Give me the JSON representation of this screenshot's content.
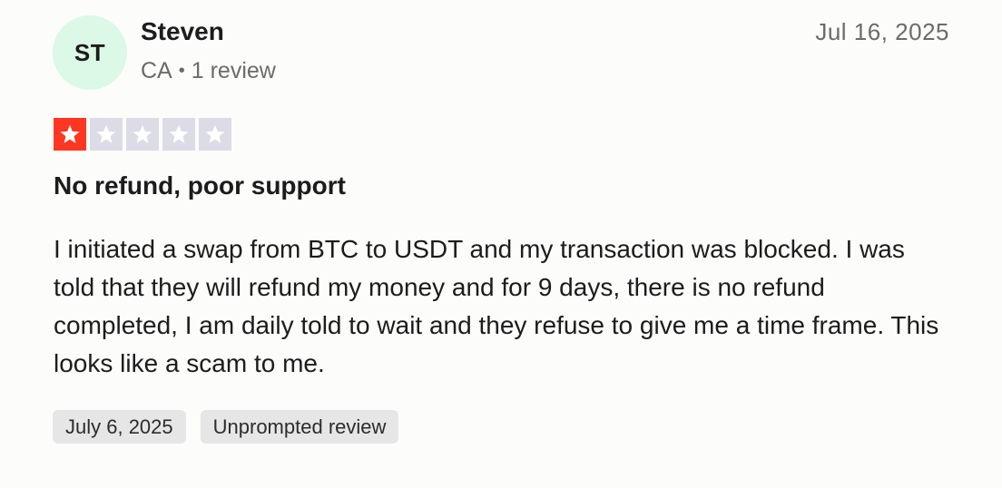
{
  "reviewer": {
    "initials": "ST",
    "name": "Steven",
    "country": "CA",
    "review_count": "1 review"
  },
  "review": {
    "date": "Jul 16, 2025",
    "rating": 1,
    "rating_max": 5,
    "title": "No refund, poor support",
    "body": "I initiated a swap from BTC to USDT and my transaction was blocked. I was told that they will refund my money and for 9 days, there is no refund completed, I am daily told to wait and they refuse to give me a time frame. This looks like a scam to me.",
    "experience_date": "July 6, 2025",
    "review_type": "Unprompted review"
  },
  "colors": {
    "star_filled": "#ff3722",
    "star_empty": "#dcdce6",
    "avatar_bg": "#dcf8e6"
  }
}
